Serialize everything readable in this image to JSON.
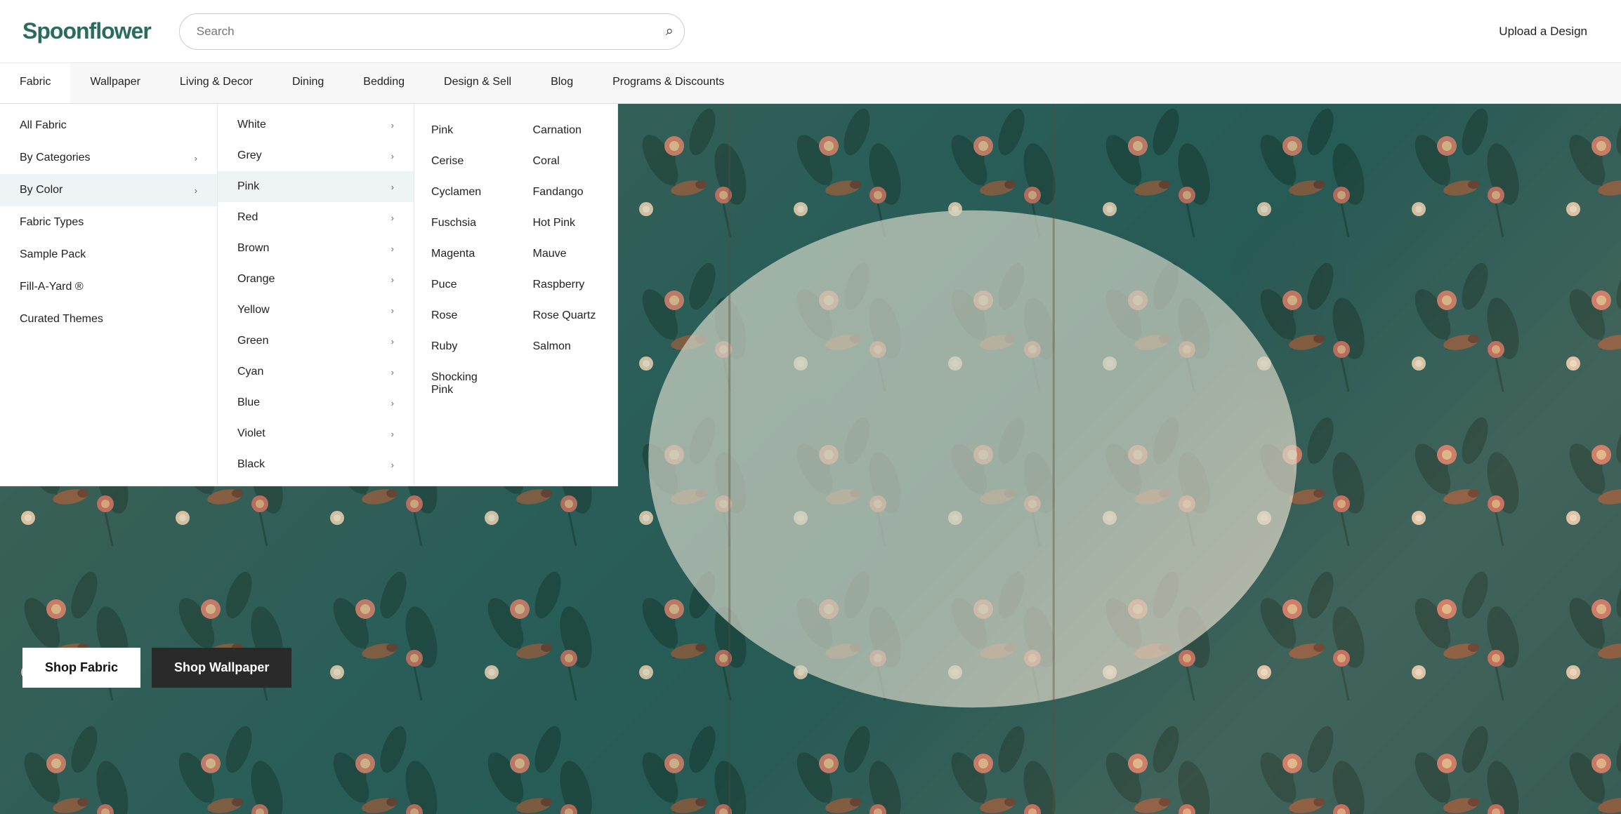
{
  "header": {
    "logo": "Spoonflower",
    "search_placeholder": "Search",
    "upload_label": "Upload a Design"
  },
  "navbar": {
    "items": [
      {
        "label": "Fabric",
        "active": true
      },
      {
        "label": "Wallpaper"
      },
      {
        "label": "Living & Decor"
      },
      {
        "label": "Dining"
      },
      {
        "label": "Bedding"
      },
      {
        "label": "Design & Sell"
      },
      {
        "label": "Blog"
      },
      {
        "label": "Programs & Discounts"
      }
    ]
  },
  "dropdown": {
    "col1": {
      "items": [
        {
          "label": "All Fabric",
          "has_arrow": false
        },
        {
          "label": "By Categories",
          "has_arrow": true
        },
        {
          "label": "By Color",
          "has_arrow": true,
          "highlighted": true
        },
        {
          "label": "Fabric Types",
          "has_arrow": false
        },
        {
          "label": "Sample Pack",
          "has_arrow": false
        },
        {
          "label": "Fill-A-Yard ®",
          "has_arrow": false
        },
        {
          "label": "Curated Themes",
          "has_arrow": false
        }
      ]
    },
    "col2": {
      "items": [
        {
          "label": "White",
          "has_arrow": true
        },
        {
          "label": "Grey",
          "has_arrow": true
        },
        {
          "label": "Pink",
          "has_arrow": true,
          "highlighted": true
        },
        {
          "label": "Red",
          "has_arrow": true
        },
        {
          "label": "Brown",
          "has_arrow": true
        },
        {
          "label": "Orange",
          "has_arrow": true
        },
        {
          "label": "Yellow",
          "has_arrow": true
        },
        {
          "label": "Green",
          "has_arrow": true
        },
        {
          "label": "Cyan",
          "has_arrow": true
        },
        {
          "label": "Blue",
          "has_arrow": true
        },
        {
          "label": "Violet",
          "has_arrow": true
        },
        {
          "label": "Black",
          "has_arrow": true
        }
      ]
    },
    "col3": {
      "items": [
        {
          "label": "Pink"
        },
        {
          "label": "Carnation"
        },
        {
          "label": "Cerise"
        },
        {
          "label": "Coral"
        },
        {
          "label": "Cyclamen"
        },
        {
          "label": "Fandango"
        },
        {
          "label": "Fuschsia"
        },
        {
          "label": "Hot Pink"
        },
        {
          "label": "Magenta"
        },
        {
          "label": "Mauve"
        },
        {
          "label": "Puce"
        },
        {
          "label": "Raspberry"
        },
        {
          "label": "Rose"
        },
        {
          "label": "Rose Quartz"
        },
        {
          "label": "Ruby"
        },
        {
          "label": "Salmon"
        },
        {
          "label": "Shocking Pink"
        }
      ]
    }
  },
  "hero": {
    "shop_fabric_label": "Shop Fabric",
    "shop_wallpaper_label": "Shop Wallpaper"
  },
  "icons": {
    "search": "🔍",
    "chevron_right": "›"
  }
}
